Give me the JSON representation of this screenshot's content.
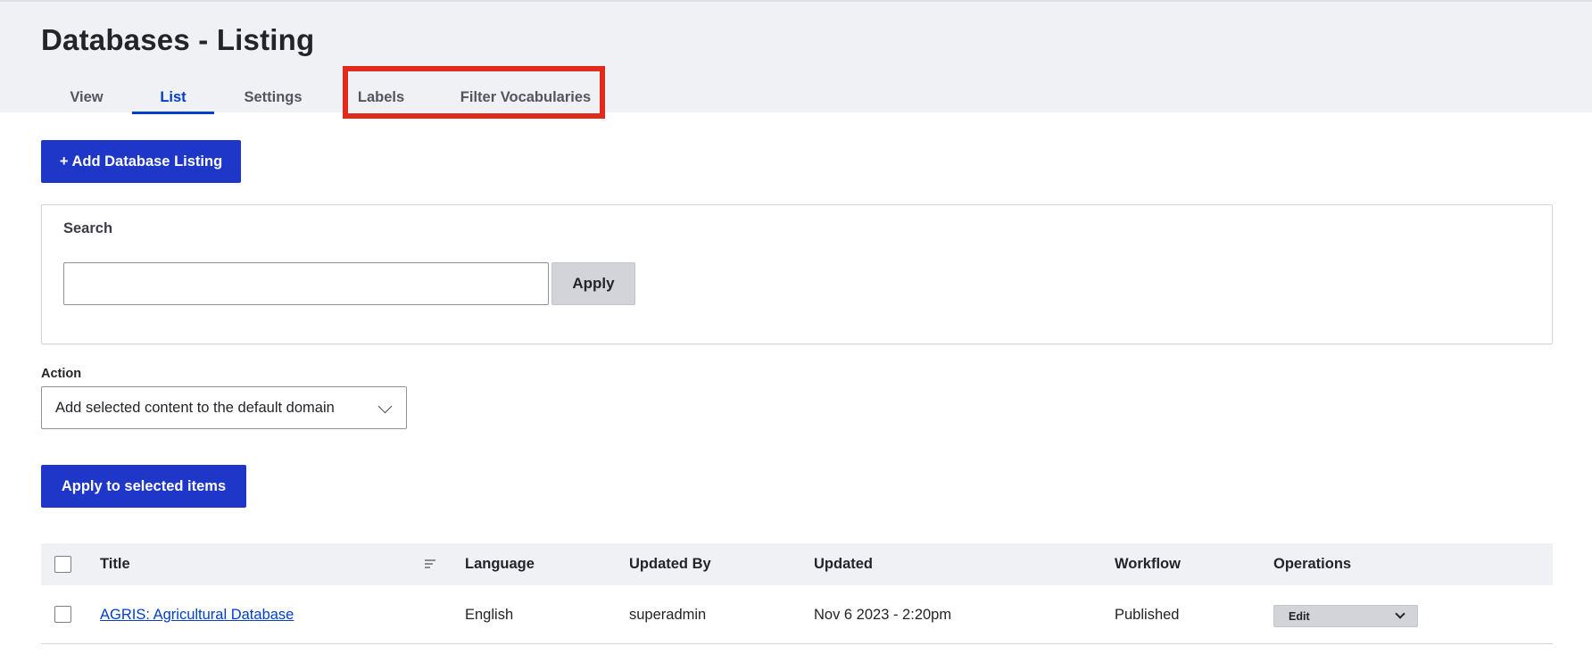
{
  "header": {
    "title": "Databases - Listing",
    "tabs": [
      {
        "label": "View"
      },
      {
        "label": "List",
        "active": true
      },
      {
        "label": "Settings"
      },
      {
        "label": "Labels"
      },
      {
        "label": "Filter Vocabularies"
      }
    ],
    "highlight_color": "#e02a1b"
  },
  "toolbar": {
    "add_label": "+ Add Database Listing"
  },
  "search": {
    "label": "Search",
    "value": "",
    "placeholder": "",
    "apply_label": "Apply"
  },
  "bulk": {
    "action_label": "Action",
    "selected_action": "Add selected content to the default domain",
    "apply_label": "Apply to selected items"
  },
  "table": {
    "columns": [
      "Title",
      "Language",
      "Updated By",
      "Updated",
      "Workflow",
      "Operations"
    ],
    "rows": [
      {
        "title": "AGRIS: Agricultural Database",
        "language": "English",
        "updated_by": "superadmin",
        "updated": "Nov 6 2023 - 2:20pm",
        "workflow": "Published",
        "operation": "Edit"
      }
    ]
  },
  "colors": {
    "primary": "#1f37c9",
    "header_bg": "#f0f1f5",
    "link": "#003ecc"
  }
}
